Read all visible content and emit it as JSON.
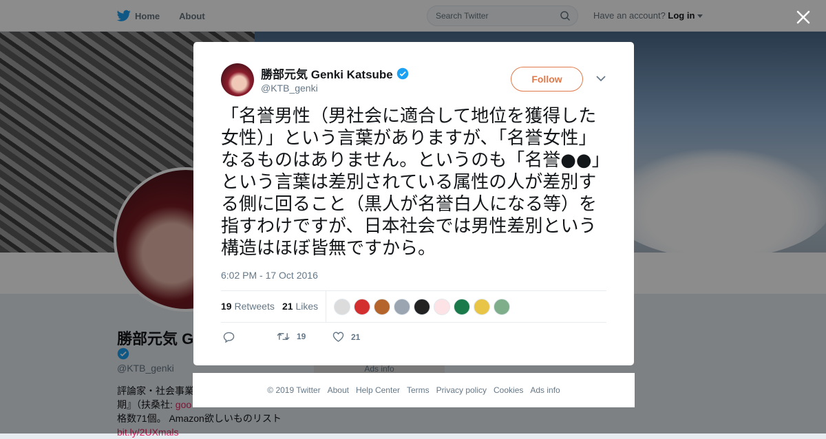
{
  "topbar": {
    "home_label": "Home",
    "about_label": "About",
    "search_placeholder": "Search Twitter",
    "account_prompt": "Have an account?",
    "login_label": "Log in"
  },
  "profile": {
    "name": "勝部元気 Ge",
    "handle": "@KTB_genki",
    "bio_line1": "評論家・社会事業",
    "bio_line2_prefix": "期』（扶桑社: ",
    "bio_line2_link": "goo",
    "bio_line3": "格数71個。 Amazon欲しいものリスト",
    "bio_line4_link": "bit.ly/2UXmals",
    "ads_info_behind": "Ads info"
  },
  "tweet": {
    "author_name": "勝部元気 Genki Katsube",
    "author_handle": "@KTB_genki",
    "follow_label": "Follow",
    "text": "「名誉男性（男社会に適合して地位を獲得した女性）」という言葉がありますが、「名誉女性」なるものはありません。というのも「名誉●●」という言葉は差別されている属性の人が差別する側に回ること（黒人が名誉白人になる等）を指すわけですが、日本社会では男性差別という構造はほぼ皆無ですから。",
    "timestamp": "6:02 PM - 17 Oct 2016",
    "retweets_count": "19",
    "retweets_label": "Retweets",
    "likes_count": "21",
    "likes_label": "Likes",
    "action_retweet_count": "19",
    "action_like_count": "21"
  },
  "likers": [
    {
      "name": "liker-1",
      "color": "#dcdcdc"
    },
    {
      "name": "liker-2",
      "color": "#d32f2f"
    },
    {
      "name": "liker-3",
      "color": "#b5652b"
    },
    {
      "name": "liker-4",
      "color": "#9aa5b1"
    },
    {
      "name": "liker-5",
      "color": "#222222"
    },
    {
      "name": "liker-6",
      "color": "#fde3e6"
    },
    {
      "name": "liker-7",
      "color": "#1b7a4a"
    },
    {
      "name": "liker-8",
      "color": "#e8c547"
    },
    {
      "name": "liker-9",
      "color": "#7fae8a"
    }
  ],
  "footer": {
    "copyright": "© 2019 Twitter",
    "about": "About",
    "help_center": "Help Center",
    "terms": "Terms",
    "privacy_policy": "Privacy policy",
    "cookies": "Cookies",
    "ads_info": "Ads info"
  },
  "colors": {
    "brand_blue": "#1da1f2",
    "follow_accent": "#e0794a",
    "verified_blue": "#1da1f2"
  }
}
